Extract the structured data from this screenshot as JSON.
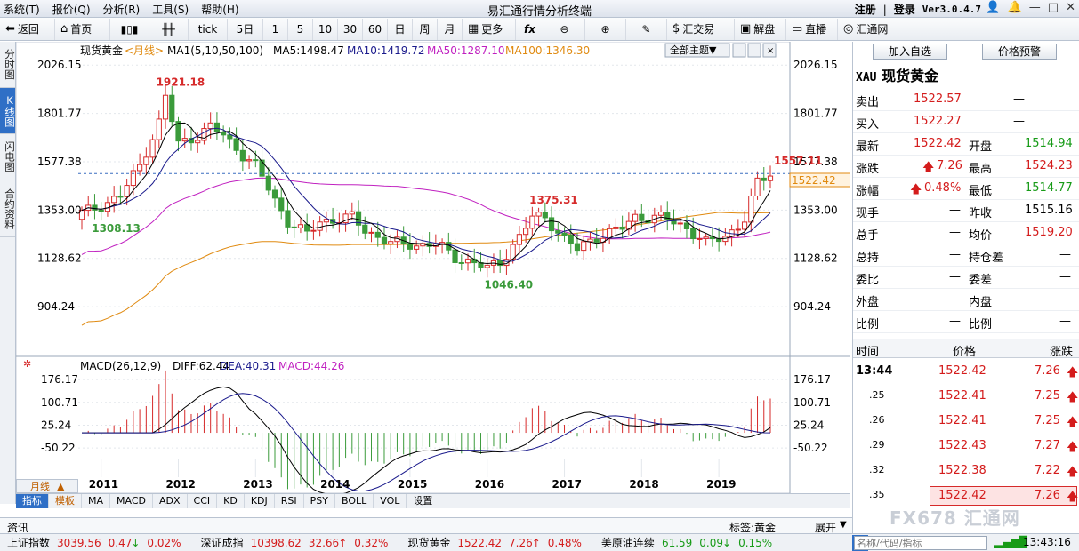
{
  "window": {
    "title": "易汇通行情分析终端",
    "menu": [
      "系统(T)",
      "报价(Q)",
      "分析(R)",
      "工具(S)",
      "帮助(H)"
    ],
    "register": "注册",
    "login": "登录",
    "version": "Ver3.0.4.7"
  },
  "toolbar": {
    "back": "返回",
    "home": "首页",
    "period5d": "5日",
    "tick": "tick",
    "num1": "1",
    "num5": "5",
    "num10": "10",
    "num30": "30",
    "num60": "60",
    "day": "日",
    "week": "周",
    "month": "月",
    "more": "更多",
    "fx": "fx",
    "exchange": "汇交易",
    "jiepan": "解盘",
    "live": "直播",
    "huitong": "汇通网"
  },
  "sidetabs": [
    "分时图",
    "K线图",
    "闪电图",
    "合约资料"
  ],
  "chart": {
    "name": "现货黄金",
    "period": "<月线>",
    "ma_title": "MA1(5,10,50,100)",
    "ma5": "MA5:1498.47",
    "ma10": "MA10:1419.72",
    "ma50": "MA50:1287.10",
    "ma100": "MA100:1346.30",
    "theme": "全部主题▼",
    "macd_title": "MACD(26,12,9)",
    "diff": "DIFF:62.44",
    "dea": "DEA:40.31",
    "macd": "MACD:44.26",
    "price_now": "1522.42",
    "colors": {
      "up": "#d62a2a",
      "down": "#3b9b3b",
      "ma5": "#000000",
      "ma10": "#1a1a8c",
      "ma50": "#c020c0",
      "ma100": "#e08a10",
      "dash": "#3a6fc0"
    }
  },
  "chart_data": [
    {
      "type": "candlestick",
      "title": "现货黄金 月线",
      "x_years": [
        "2011",
        "2012",
        "2013",
        "2014",
        "2015",
        "2016",
        "2017",
        "2018",
        "2019"
      ],
      "y_ticks": [
        "2026.15",
        "1801.77",
        "1577.38",
        "1353.00",
        "1128.62",
        "904.24"
      ],
      "ylim": [
        690,
        2060
      ],
      "annotations": [
        {
          "label": "1921.18",
          "type": "high",
          "date": "2011-09"
        },
        {
          "label": "1308.13",
          "type": "low",
          "date": "2010-11"
        },
        {
          "label": "1046.40",
          "type": "low",
          "date": "2015-12"
        },
        {
          "label": "1375.31",
          "type": "high",
          "date": "2016-07"
        },
        {
          "label": "1557.11",
          "type": "high",
          "date": "2019-09"
        }
      ],
      "series": [
        {
          "name": "MA5",
          "last": 1498.47
        },
        {
          "name": "MA10",
          "last": 1419.72
        },
        {
          "name": "MA50",
          "last": 1287.1
        },
        {
          "name": "MA100",
          "last": 1346.3
        }
      ],
      "last_price": 1522.42
    },
    {
      "type": "bar",
      "title": "MACD(26,12,9)",
      "y_ticks": [
        "176.17",
        "100.71",
        "25.24",
        "-50.22"
      ],
      "ylim": [
        -88,
        200
      ],
      "series": [
        {
          "name": "DIFF",
          "last": 62.44
        },
        {
          "name": "DEA",
          "last": 40.31
        },
        {
          "name": "MACD",
          "last": 44.26
        }
      ]
    }
  ],
  "bottom_tabs": {
    "period": "月线",
    "tabs": [
      "指标",
      "模板",
      "MA",
      "MACD",
      "ADX",
      "CCI",
      "KD",
      "KDJ",
      "RSI",
      "PSY",
      "BOLL",
      "VOL",
      "设置"
    ]
  },
  "info": {
    "left": "资讯",
    "mid": "标签:黄金",
    "right": "展开"
  },
  "quote": {
    "add": "加入自选",
    "alert": "价格预警",
    "symbol": "XAU",
    "name": "现货黄金",
    "sell_l": "卖出",
    "sell": "1522.57",
    "buy_l": "买入",
    "buy": "1522.27",
    "dash": "—",
    "last_l": "最新",
    "last": "1522.42",
    "open_l": "开盘",
    "open": "1514.94",
    "chg_l": "涨跌",
    "chg": "7.26",
    "high_l": "最高",
    "high": "1524.23",
    "pct_l": "涨幅",
    "pct": "0.48%",
    "low_l": "最低",
    "low": "1514.77",
    "hand_l": "现手",
    "prev_l": "昨收",
    "prev": "1515.16",
    "total_l": "总手",
    "avg_l": "均价",
    "avg": "1519.20",
    "hold_l": "总持",
    "holdchg_l": "持仓差",
    "ratio_l": "委比",
    "wdiff_l": "委差",
    "outer_l": "外盘",
    "inner_l": "内盘",
    "bratio_l": "比例",
    "bratio2_l": "比例",
    "th_time": "时间",
    "th_price": "价格",
    "th_chg": "涨跌",
    "ticks": [
      {
        "t": "13:44",
        "p": "1522.42",
        "c": "7.26"
      },
      {
        "t": ".25",
        "p": "1522.41",
        "c": "7.25"
      },
      {
        "t": ".26",
        "p": "1522.41",
        "c": "7.25"
      },
      {
        "t": ".29",
        "p": "1522.43",
        "c": "7.27"
      },
      {
        "t": ".32",
        "p": "1522.38",
        "c": "7.22"
      },
      {
        "t": ".35",
        "p": "1522.42",
        "c": "7.26"
      }
    ]
  },
  "status": {
    "sh": "上证指数",
    "shv": "3039.56",
    "shc": "0.47",
    "shp": "0.02%",
    "sz": "深证成指",
    "szv": "10398.62",
    "szc": "32.66",
    "szp": "0.32%",
    "gold": "现货黄金",
    "goldv": "1522.42",
    "goldc": "7.26",
    "goldp": "0.48%",
    "oil": "美原油连续",
    "oilv": "61.59",
    "oilc": "0.09",
    "oilp": "0.15%",
    "search_ph": "名称/代码/指标",
    "time": "13:43:16",
    "btn": "笔"
  },
  "watermark": "FX678 汇通网"
}
